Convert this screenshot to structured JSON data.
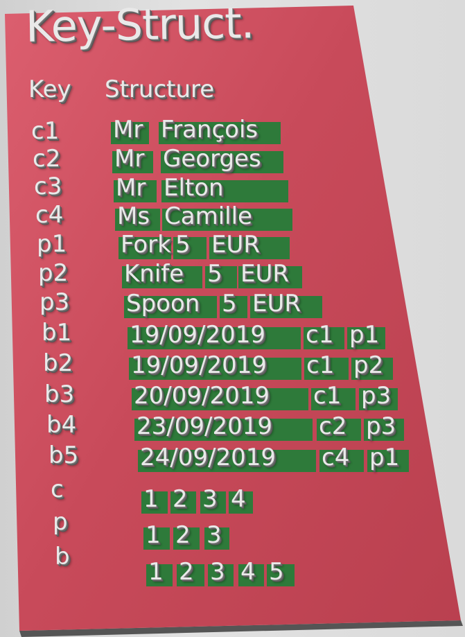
{
  "title": "Key-Struct.",
  "headers": {
    "key": "Key",
    "structure": "Structure"
  },
  "rows": [
    {
      "key": "c1",
      "cells": [
        "Mr",
        "François"
      ]
    },
    {
      "key": "c2",
      "cells": [
        "Mr",
        "Georges"
      ]
    },
    {
      "key": "c3",
      "cells": [
        "Mr",
        "Elton"
      ]
    },
    {
      "key": "c4",
      "cells": [
        "Ms",
        "Camille"
      ]
    },
    {
      "key": "p1",
      "cells": [
        "Fork",
        "5",
        "EUR"
      ]
    },
    {
      "key": "p2",
      "cells": [
        "Knife",
        "5",
        "EUR"
      ]
    },
    {
      "key": "p3",
      "cells": [
        "Spoon",
        "5",
        "EUR"
      ]
    },
    {
      "key": "b1",
      "cells": [
        "19/09/2019",
        "c1",
        "p1"
      ]
    },
    {
      "key": "b2",
      "cells": [
        "19/09/2019",
        "c1",
        "p2"
      ]
    },
    {
      "key": "b3",
      "cells": [
        "20/09/2019",
        "c1",
        "p3"
      ]
    },
    {
      "key": "b4",
      "cells": [
        "23/09/2019",
        "c2",
        "p3"
      ]
    },
    {
      "key": "b5",
      "cells": [
        "24/09/2019",
        "c4",
        "p1"
      ]
    },
    {
      "key": "c",
      "cells": [
        "1",
        "2",
        "3",
        "4"
      ]
    },
    {
      "key": "p",
      "cells": [
        "1",
        "2",
        "3"
      ]
    },
    {
      "key": "b",
      "cells": [
        "1",
        "2",
        "3",
        "4",
        "5"
      ]
    }
  ],
  "colors": {
    "panel": "#c84a5a",
    "cell": "#2e7a3a",
    "text": "#e9e9e9"
  }
}
